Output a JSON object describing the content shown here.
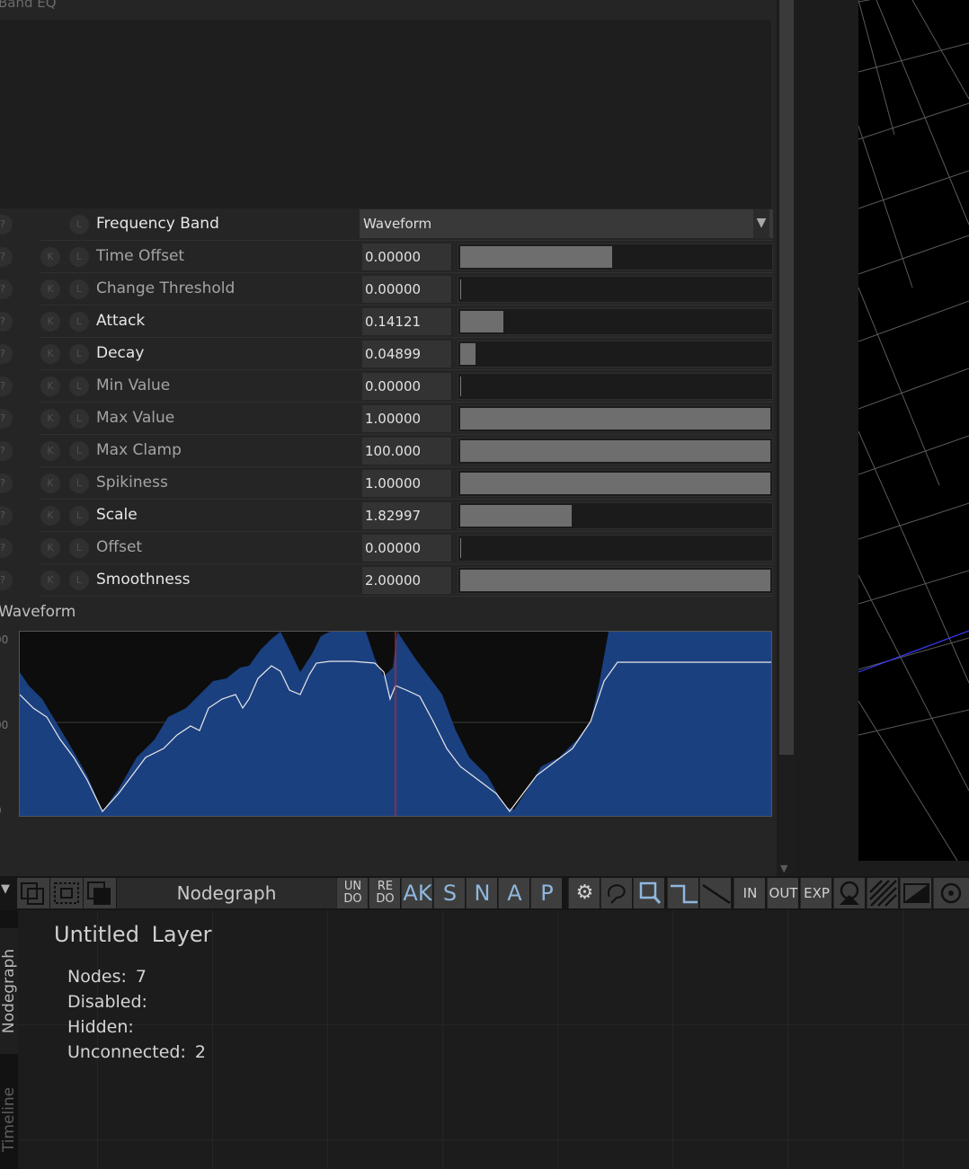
{
  "panel": {
    "title": "Band EQ"
  },
  "frequency_band": {
    "label": "Frequency Band",
    "value": "Waveform",
    "l_label": "L",
    "help_label": "?"
  },
  "buttons": {
    "help": "?",
    "keyframe": "K",
    "link": "L"
  },
  "params": [
    {
      "label": "Time Offset",
      "value": "0.00000",
      "fill": 0.49,
      "active": false
    },
    {
      "label": "Change Threshold",
      "value": "0.00000",
      "fill": 0.0,
      "active": false
    },
    {
      "label": "Attack",
      "value": "0.14121",
      "fill": 0.14,
      "active": true
    },
    {
      "label": "Decay",
      "value": "0.04899",
      "fill": 0.05,
      "active": true
    },
    {
      "label": "Min Value",
      "value": "0.00000",
      "fill": 0.0,
      "active": false
    },
    {
      "label": "Max Value",
      "value": "1.00000",
      "fill": 1.0,
      "active": false
    },
    {
      "label": "Max Clamp",
      "value": "100.000",
      "fill": 1.0,
      "active": false
    },
    {
      "label": "Spikiness",
      "value": "1.00000",
      "fill": 1.0,
      "active": false
    },
    {
      "label": "Scale",
      "value": "1.82997",
      "fill": 0.36,
      "active": true
    },
    {
      "label": "Offset",
      "value": "0.00000",
      "fill": 0.0,
      "active": false
    },
    {
      "label": "Smoothness",
      "value": "2.00000",
      "fill": 1.0,
      "active": true
    }
  ],
  "waveform": {
    "label": "Waveform",
    "y_ticks": [
      "00",
      "00",
      "0"
    ],
    "fill_color": "#1b4080",
    "line_color": "#e8e8e8",
    "cursor_color": "#cc2222",
    "cursor_pos": 0.5
  },
  "toolbar": {
    "title": "Nodegraph",
    "undo": [
      "UN",
      "DO"
    ],
    "redo": [
      "RE",
      "DO"
    ],
    "letters": [
      "AK",
      "S",
      "N",
      "A",
      "P"
    ],
    "in_label": "IN",
    "out_label": "OUT",
    "exp_label": "EXP"
  },
  "nodegraph": {
    "tabs": [
      "Nodegraph",
      "Timeline"
    ],
    "layer_title": "Untitled Layer",
    "stats": [
      {
        "label": "Nodes:",
        "value": "7"
      },
      {
        "label": "Disabled:",
        "value": ""
      },
      {
        "label": "Hidden:",
        "value": ""
      },
      {
        "label": "Unconnected:",
        "value": "2"
      }
    ]
  },
  "colors": {
    "accent": "#8fb7dd",
    "viewport_line": "#3a3aff"
  }
}
